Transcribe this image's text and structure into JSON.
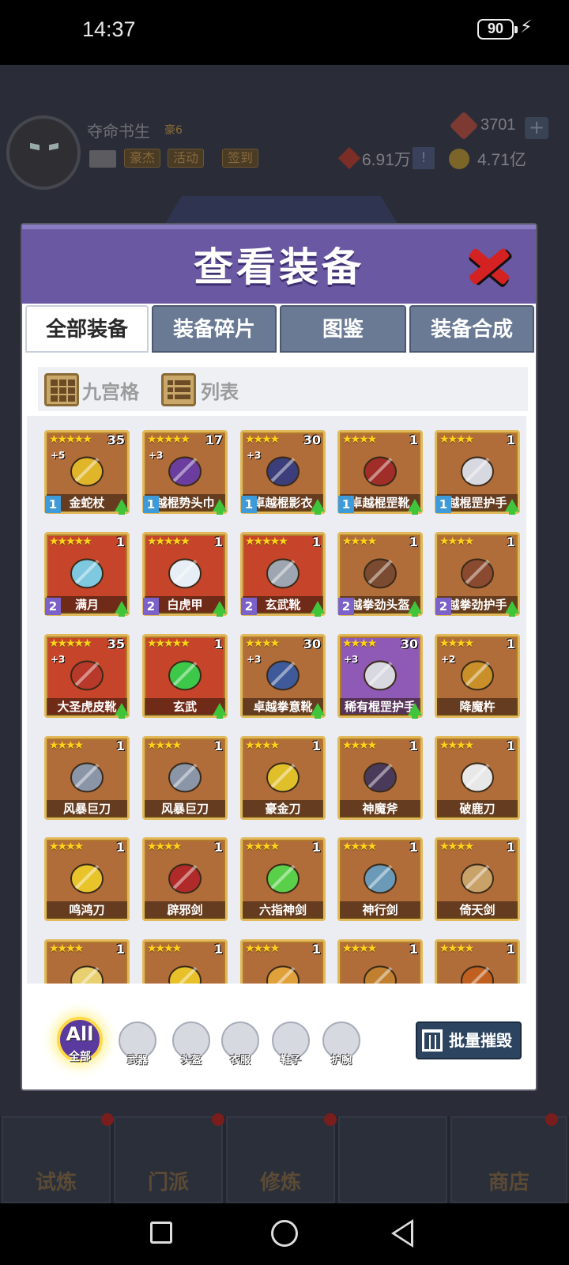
{
  "status_bar": {
    "time": "14:37",
    "battery": "90"
  },
  "background_hud": {
    "player_name": "夺命书生",
    "vip": "豪6",
    "buttons": [
      "豪杰",
      "活动",
      "签到"
    ],
    "gems": "3701",
    "gem_plus": "+",
    "power": "6.91万",
    "power_alert": "!",
    "coins": "4.71亿"
  },
  "modal": {
    "title": "查看装备",
    "tabs": [
      {
        "label": "全部装备",
        "active": true
      },
      {
        "label": "装备碎片",
        "active": false
      },
      {
        "label": "图鉴",
        "active": false
      },
      {
        "label": "装备合成",
        "active": false
      }
    ],
    "view_modes": [
      {
        "label": "九宫格"
      },
      {
        "label": "列表"
      }
    ],
    "items": [
      {
        "name": "金蛇杖",
        "stars": "★★★★★",
        "count": "35",
        "plus": "+5",
        "rank": "1",
        "upgrade": true,
        "bg": "#b06d3a",
        "icon": "staff-icon",
        "art": "#e0b52a"
      },
      {
        "name": "越棍势头巾",
        "stars": "★★★★★",
        "count": "17",
        "plus": "+3",
        "rank": "1",
        "upgrade": true,
        "bg": "#b06d3a",
        "icon": "headband-icon",
        "art": "#6a3d9e"
      },
      {
        "name": "卓越棍影衣",
        "stars": "★★★★",
        "count": "30",
        "plus": "+3",
        "rank": "1",
        "upgrade": true,
        "bg": "#b06d3a",
        "icon": "robe-icon",
        "art": "#3b3e7a"
      },
      {
        "name": "卓越棍罡靴",
        "stars": "★★★★",
        "count": "1",
        "plus": "",
        "rank": "1",
        "upgrade": true,
        "bg": "#b06d3a",
        "icon": "shoe-icon",
        "art": "#a12d28"
      },
      {
        "name": "越棍罡护手",
        "stars": "★★★★",
        "count": "1",
        "plus": "",
        "rank": "1",
        "upgrade": true,
        "bg": "#b06d3a",
        "icon": "bracer-icon",
        "art": "#d8d8e0"
      },
      {
        "name": "满月",
        "stars": "★★★★★",
        "count": "1",
        "plus": "",
        "rank": "2",
        "upgrade": true,
        "bg": "#c6452a",
        "icon": "moon-ornament-icon",
        "art": "#7ec8e0"
      },
      {
        "name": "白虎甲",
        "stars": "★★★★★",
        "count": "1",
        "plus": "",
        "rank": "2",
        "upgrade": true,
        "bg": "#c6452a",
        "icon": "armor-icon",
        "art": "#e8eef5"
      },
      {
        "name": "玄武靴",
        "stars": "★★★★★",
        "count": "1",
        "plus": "",
        "rank": "2",
        "upgrade": true,
        "bg": "#c6452a",
        "icon": "boot-icon",
        "art": "#9ea6b2"
      },
      {
        "name": "越拳劲头盔",
        "stars": "★★★★",
        "count": "1",
        "plus": "",
        "rank": "2",
        "upgrade": true,
        "bg": "#b06d3a",
        "icon": "helmet-icon",
        "art": "#7a4b30"
      },
      {
        "name": "越拳劲护手",
        "stars": "★★★★",
        "count": "1",
        "plus": "",
        "rank": "2",
        "upgrade": true,
        "bg": "#b06d3a",
        "icon": "bracer-icon",
        "art": "#8a4a30"
      },
      {
        "name": "大圣虎皮靴",
        "stars": "★★★★★",
        "count": "35",
        "plus": "+3",
        "rank": "",
        "upgrade": true,
        "bg": "#c6452a",
        "icon": "boot-icon",
        "art": "#b8382a"
      },
      {
        "name": "玄武",
        "stars": "★★★★★",
        "count": "1",
        "plus": "",
        "rank": "",
        "upgrade": true,
        "bg": "#c6452a",
        "icon": "jade-turtle-icon",
        "art": "#3ec84a"
      },
      {
        "name": "卓越拳意靴",
        "stars": "★★★★",
        "count": "30",
        "plus": "+3",
        "rank": "",
        "upgrade": true,
        "bg": "#b06d3a",
        "icon": "boot-icon",
        "art": "#3e5a9a"
      },
      {
        "name": "稀有棍罡护手",
        "stars": "★★★★",
        "count": "30",
        "plus": "+3",
        "rank": "",
        "upgrade": true,
        "bg": "#8e5ab6",
        "icon": "bracer-icon",
        "art": "#d8d8e0"
      },
      {
        "name": "降魔杵",
        "stars": "★★★★",
        "count": "1",
        "plus": "+2",
        "rank": "",
        "upgrade": false,
        "bg": "#b06d3a",
        "icon": "pestle-icon",
        "art": "#c9902a"
      },
      {
        "name": "风暴巨刀",
        "stars": "★★★★",
        "count": "1",
        "plus": "",
        "rank": "",
        "upgrade": false,
        "bg": "#b06d3a",
        "icon": "greatsword-icon",
        "art": "#8a96a8"
      },
      {
        "name": "风暴巨刀",
        "stars": "★★★★",
        "count": "1",
        "plus": "",
        "rank": "",
        "upgrade": false,
        "bg": "#b06d3a",
        "icon": "greatsword-icon",
        "art": "#8a96a8"
      },
      {
        "name": "豪金刀",
        "stars": "★★★★",
        "count": "1",
        "plus": "",
        "rank": "",
        "upgrade": false,
        "bg": "#b06d3a",
        "icon": "golden-blade-icon",
        "art": "#e0c02a"
      },
      {
        "name": "神魔斧",
        "stars": "★★★★",
        "count": "1",
        "plus": "",
        "rank": "",
        "upgrade": false,
        "bg": "#b06d3a",
        "icon": "axe-icon",
        "art": "#4a3a5a"
      },
      {
        "name": "破鹿刀",
        "stars": "★★★★",
        "count": "1",
        "plus": "",
        "rank": "",
        "upgrade": false,
        "bg": "#b06d3a",
        "icon": "sabre-icon",
        "art": "#e8e8e8"
      },
      {
        "name": "鸣鸿刀",
        "stars": "★★★★",
        "count": "1",
        "plus": "",
        "rank": "",
        "upgrade": false,
        "bg": "#b06d3a",
        "icon": "broadsword-icon",
        "art": "#e8c42a"
      },
      {
        "name": "辟邪剑",
        "stars": "★★★★",
        "count": "1",
        "plus": "",
        "rank": "",
        "upgrade": false,
        "bg": "#b06d3a",
        "icon": "sword-icon",
        "art": "#b02a2a"
      },
      {
        "name": "六指神剑",
        "stars": "★★★★",
        "count": "1",
        "plus": "",
        "rank": "",
        "upgrade": false,
        "bg": "#b06d3a",
        "icon": "jade-hand-icon",
        "art": "#5ad04a"
      },
      {
        "name": "神行剑",
        "stars": "★★★★",
        "count": "1",
        "plus": "",
        "rank": "",
        "upgrade": false,
        "bg": "#b06d3a",
        "icon": "sword-icon",
        "art": "#6a9ab8"
      },
      {
        "name": "倚天剑",
        "stars": "★★★★",
        "count": "1",
        "plus": "",
        "rank": "",
        "upgrade": false,
        "bg": "#b06d3a",
        "icon": "sword-icon",
        "art": "#c9a26a"
      },
      {
        "name": "",
        "stars": "★★★★",
        "count": "1",
        "plus": "",
        "rank": "",
        "upgrade": false,
        "bg": "#b06d3a",
        "icon": "sword-icon",
        "art": "#e8d070"
      },
      {
        "name": "",
        "stars": "★★★★",
        "count": "1",
        "plus": "",
        "rank": "",
        "upgrade": false,
        "bg": "#b06d3a",
        "icon": "sword-icon",
        "art": "#e8c02a"
      },
      {
        "name": "",
        "stars": "★★★★",
        "count": "1",
        "plus": "",
        "rank": "",
        "upgrade": false,
        "bg": "#b06d3a",
        "icon": "fist-icon",
        "art": "#e0a03a"
      },
      {
        "name": "",
        "stars": "★★★★",
        "count": "1",
        "plus": "",
        "rank": "",
        "upgrade": false,
        "bg": "#b06d3a",
        "icon": "claw-icon",
        "art": "#c08030"
      },
      {
        "name": "",
        "stars": "★★★★",
        "count": "1",
        "plus": "",
        "rank": "",
        "upgrade": false,
        "bg": "#b06d3a",
        "icon": "claw-icon",
        "art": "#c06020"
      }
    ],
    "filters": {
      "all_icon": "All",
      "all_label": "全部",
      "items": [
        {
          "label": "武器",
          "icon": "crossed-swords-icon"
        },
        {
          "label": "头盔",
          "icon": "helmet-icon"
        },
        {
          "label": "衣服",
          "icon": "shirt-icon"
        },
        {
          "label": "鞋子",
          "icon": "boot-icon"
        },
        {
          "label": "护腕",
          "icon": "bracer-icon"
        }
      ]
    },
    "bulk_destroy": "批量摧毁"
  },
  "bottom_nav": [
    {
      "label": "试炼"
    },
    {
      "label": "门派"
    },
    {
      "label": "修炼"
    },
    {
      "label": ""
    },
    {
      "label": "商店"
    }
  ],
  "colors": {
    "accent": "#6a58a2",
    "tab_inactive": "#6a7a94",
    "gold_border": "#e1b95a",
    "legendary": "#c6452a",
    "epic": "#8e5ab6"
  }
}
